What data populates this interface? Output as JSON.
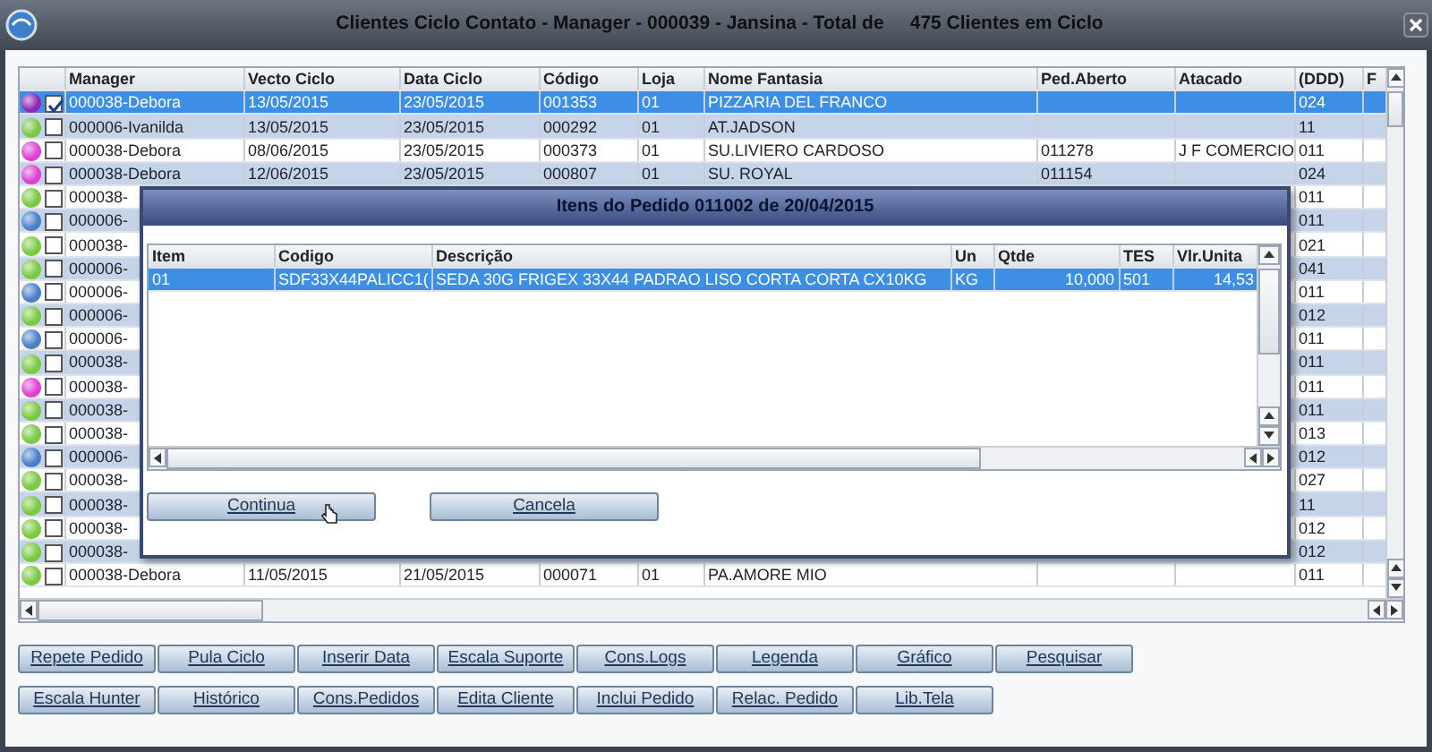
{
  "window": {
    "title": "Clientes Ciclo Contato - Manager - 000039 - Jansina - Total de     475 Clientes em Ciclo"
  },
  "grid": {
    "columns": [
      "Manager",
      "Vecto Ciclo",
      "Data Ciclo",
      "Código",
      "Loja",
      "Nome Fantasia",
      "Ped.Aberto",
      "Atacado",
      "(DDD)",
      "F"
    ],
    "rows": [
      {
        "color": "#8e2bb0",
        "checked": true,
        "selected": true,
        "cells": [
          "000038-Debora",
          "13/05/2015",
          "23/05/2015",
          "001353",
          "01",
          "PIZZARIA DEL FRANCO",
          "",
          "",
          "024"
        ]
      },
      {
        "color": "#7ac943",
        "checked": false,
        "selected": false,
        "cells": [
          "000006-Ivanilda",
          "13/05/2015",
          "23/05/2015",
          "000292",
          "01",
          "AT.JADSON",
          "",
          "",
          "11"
        ]
      },
      {
        "color": "#e040d0",
        "checked": false,
        "selected": false,
        "cells": [
          "000038-Debora",
          "08/06/2015",
          "23/05/2015",
          "000373",
          "01",
          "SU.LIVIERO CARDOSO",
          "011278",
          "J F COMERCIO",
          "011"
        ]
      },
      {
        "color": "#e040d0",
        "checked": false,
        "selected": false,
        "cells": [
          "000038-Debora",
          "12/06/2015",
          "23/05/2015",
          "000807",
          "01",
          "SU. ROYAL",
          "011154",
          "",
          "024"
        ]
      },
      {
        "color": "#7ac943",
        "checked": false,
        "selected": false,
        "cells": [
          "000038-",
          "",
          "",
          "",
          "",
          "",
          "",
          "",
          "011"
        ]
      },
      {
        "color": "#4a7fc8",
        "checked": false,
        "selected": false,
        "cells": [
          "000006-",
          "",
          "",
          "",
          "",
          "",
          "",
          "",
          "011"
        ]
      },
      {
        "color": "#7ac943",
        "checked": false,
        "selected": false,
        "cells": [
          "000038-",
          "",
          "",
          "",
          "",
          "",
          "",
          "",
          "021"
        ]
      },
      {
        "color": "#7ac943",
        "checked": false,
        "selected": false,
        "cells": [
          "000006-",
          "",
          "",
          "",
          "",
          "",
          "",
          "",
          "041"
        ]
      },
      {
        "color": "#4a7fc8",
        "checked": false,
        "selected": false,
        "cells": [
          "000006-",
          "",
          "",
          "",
          "",
          "",
          "",
          "",
          "011"
        ]
      },
      {
        "color": "#7ac943",
        "checked": false,
        "selected": false,
        "cells": [
          "000006-",
          "",
          "",
          "",
          "",
          "",
          "",
          "",
          "012"
        ]
      },
      {
        "color": "#4a7fc8",
        "checked": false,
        "selected": false,
        "cells": [
          "000006-",
          "",
          "",
          "",
          "",
          "",
          "",
          "",
          "011"
        ]
      },
      {
        "color": "#7ac943",
        "checked": false,
        "selected": false,
        "cells": [
          "000038-",
          "",
          "",
          "",
          "",
          "",
          "",
          "",
          "011"
        ]
      },
      {
        "color": "#e040d0",
        "checked": false,
        "selected": false,
        "cells": [
          "000038-",
          "",
          "",
          "",
          "",
          "",
          "",
          "",
          "011"
        ]
      },
      {
        "color": "#7ac943",
        "checked": false,
        "selected": false,
        "cells": [
          "000038-",
          "",
          "",
          "",
          "",
          "",
          "",
          "",
          "011"
        ]
      },
      {
        "color": "#7ac943",
        "checked": false,
        "selected": false,
        "cells": [
          "000038-",
          "",
          "",
          "",
          "",
          "",
          "",
          "",
          "013"
        ]
      },
      {
        "color": "#4a7fc8",
        "checked": false,
        "selected": false,
        "cells": [
          "000006-",
          "",
          "",
          "",
          "",
          "",
          "",
          "",
          "012"
        ]
      },
      {
        "color": "#7ac943",
        "checked": false,
        "selected": false,
        "cells": [
          "000038-",
          "",
          "",
          "",
          "",
          "",
          "",
          "",
          "027"
        ]
      },
      {
        "color": "#7ac943",
        "checked": false,
        "selected": false,
        "cells": [
          "000038-",
          "",
          "",
          "",
          "",
          "",
          "",
          "",
          "11"
        ]
      },
      {
        "color": "#7ac943",
        "checked": false,
        "selected": false,
        "cells": [
          "000038-",
          "",
          "",
          "",
          "",
          "",
          "",
          "",
          "012"
        ]
      },
      {
        "color": "#7ac943",
        "checked": false,
        "selected": false,
        "cells": [
          "000038-",
          "",
          "",
          "",
          "",
          "",
          "",
          "",
          "012"
        ]
      },
      {
        "color": "#7ac943",
        "checked": false,
        "selected": false,
        "cells": [
          "000038-Debora",
          "11/05/2015",
          "21/05/2015",
          "000071",
          "01",
          "PA.AMORE MIO",
          "",
          "",
          "011"
        ]
      }
    ]
  },
  "dialog": {
    "title": "Itens do Pedido 011002 de 20/04/2015",
    "columns": [
      "Item",
      "Codigo",
      "Descrição",
      "Un",
      "Qtde",
      "TES",
      "Vlr.Unita"
    ],
    "rows": [
      {
        "selected": true,
        "cells": [
          "01",
          "SDF33X44PALICC1(",
          "SEDA 30G FRIGEX 33X44 PADRAO LISO CORTA CORTA CX10KG",
          "KG",
          "10,000",
          "501",
          "14,53"
        ]
      }
    ],
    "buttons": [
      "Continua",
      "Cancela"
    ]
  },
  "buttons": [
    [
      "Repete Pedido",
      "Pula Ciclo",
      "Inserir Data",
      "Escala Suporte",
      "Cons.Logs",
      "Legenda",
      "Gráfico",
      "Pesquisar"
    ],
    [
      "Escala Hunter",
      "Histórico",
      "Cons.Pedidos",
      "Edita Cliente",
      "Inclui Pedido",
      "Relac. Pedido",
      "Lib.Tela"
    ]
  ]
}
